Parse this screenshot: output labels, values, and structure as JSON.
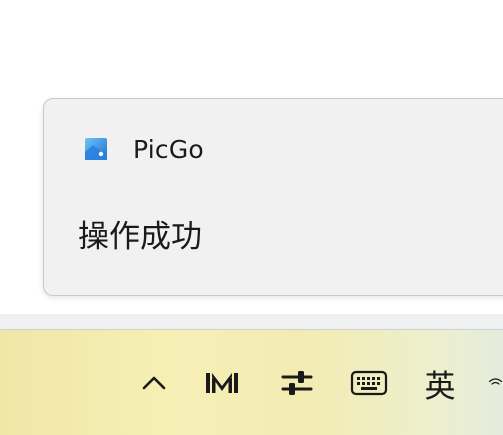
{
  "notification": {
    "app_name": "PicGo",
    "app_icon": "picgo-app-icon",
    "message": "操作成功"
  },
  "taskbar": {
    "tray_items": [
      {
        "icon": "chevron-up-icon"
      },
      {
        "icon": "app-tray-icon"
      },
      {
        "icon": "sliders-icon"
      },
      {
        "icon": "keyboard-icon"
      },
      {
        "ime_label": "英"
      }
    ]
  },
  "colors": {
    "toast_bg": "#f1f1f1",
    "toast_border": "#c8c8c8",
    "taskbar_gradient_start": "#efe7a6",
    "taskbar_gradient_end": "#e5ecdc"
  }
}
